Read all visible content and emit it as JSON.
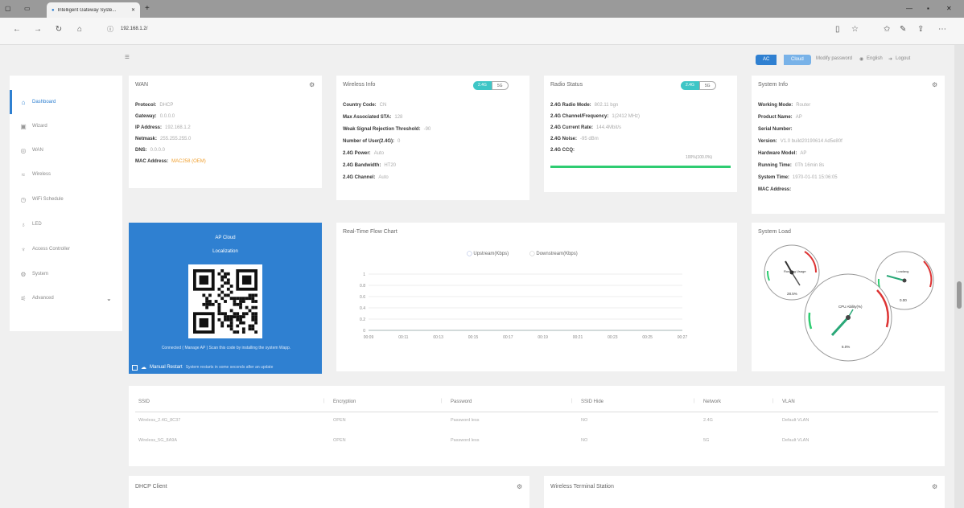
{
  "browser": {
    "tab_title": "Intelligent Gateway Syste...",
    "url": "192.168.1.2/",
    "new_tab": "+"
  },
  "header": {
    "segment": [
      "AC",
      "Cloud"
    ],
    "links": [
      "Modify password",
      "English",
      "Logout"
    ]
  },
  "sidebar": {
    "items": [
      {
        "label": "Dashboard",
        "icon": "home-icon"
      },
      {
        "label": "Wizard",
        "icon": "wizard-icon"
      },
      {
        "label": "WAN",
        "icon": "globe-icon"
      },
      {
        "label": "Wireless",
        "icon": "wifi-icon"
      },
      {
        "label": "WiFi Schedule",
        "icon": "clock-icon"
      },
      {
        "label": "LED",
        "icon": "bulb-icon"
      },
      {
        "label": "Access Controller",
        "icon": "controller-icon"
      },
      {
        "label": "System",
        "icon": "gear-icon"
      },
      {
        "label": "Advanced",
        "icon": "advanced-icon"
      }
    ]
  },
  "wan": {
    "title": "WAN",
    "rows": [
      {
        "k": "Protocol:",
        "v": "DHCP"
      },
      {
        "k": "Gateway:",
        "v": "0.0.0.0"
      },
      {
        "k": "IP Address:",
        "v": "192.168.1.2"
      },
      {
        "k": "Netmask:",
        "v": "255.255.255.0"
      },
      {
        "k": "DNS:",
        "v": "0.0.0.0"
      },
      {
        "k": "MAC Address:",
        "v": "MAC258 (OEM)"
      }
    ]
  },
  "wireless_info": {
    "title": "Wireless Info",
    "toggle": [
      "2.4G",
      "5G"
    ],
    "rows": [
      {
        "k": "Country Code:",
        "v": "CN"
      },
      {
        "k": "Max Associated STA:",
        "v": "128"
      },
      {
        "k": "Weak Signal Rejection Threshold:",
        "v": "-90"
      },
      {
        "k": "Number of User(2.4G):",
        "v": "0"
      },
      {
        "k": "2.4G Power:",
        "v": "Auto"
      },
      {
        "k": "2.4G Bandwidth:",
        "v": "HT20"
      },
      {
        "k": "2.4G Channel:",
        "v": "Auto"
      }
    ]
  },
  "radio_status": {
    "title": "Radio Status",
    "toggle": [
      "2.4G",
      "5G"
    ],
    "rows": [
      {
        "k": "2.4G Radio Mode:",
        "v": "802.11 bgn"
      },
      {
        "k": "2.4G Channel/Frequency:",
        "v": "1(2412 MHz)"
      },
      {
        "k": "2.4G Current Rate:",
        "v": "144.4Mbit/s"
      },
      {
        "k": "2.4G Noise:",
        "v": "-95 dBm"
      },
      {
        "k": "2.4G CCQ:",
        "v": ""
      }
    ],
    "ccq_value": "100%(100.0%)",
    "ccq_fraction": 1.0
  },
  "system_info": {
    "title": "System Info",
    "rows": [
      {
        "k": "Working Mode:",
        "v": "Router"
      },
      {
        "k": "Product Name:",
        "v": "AP"
      },
      {
        "k": "Serial Number:",
        "v": ""
      },
      {
        "k": "Version:",
        "v": "V1.0 build20190614 Ad5e80f"
      },
      {
        "k": "Hardware Model:",
        "v": "AP"
      },
      {
        "k": "Running Time:",
        "v": "0Th 16min 8s"
      },
      {
        "k": "System Time:",
        "v": "1970-01-01 15:06:05"
      },
      {
        "k": "MAC Address:",
        "v": ""
      }
    ]
  },
  "cloud": {
    "title": "AP Cloud",
    "subtitle": "Localization",
    "hint": "Connected ( Manage AP ) Scan this code by installing the system Wapp.",
    "manual": "Manual Restart",
    "manual_note": "System restarts in some seconds after an update"
  },
  "realtime_chart": {
    "title": "Real-Time Flow Chart"
  },
  "chart_data": {
    "type": "line",
    "title": "Real-Time Flow Chart",
    "series": [
      {
        "name": "Upstream(Kbps)",
        "values": [
          0,
          0,
          0,
          0,
          0,
          0,
          0,
          0,
          0,
          0,
          0,
          0,
          0,
          0,
          0,
          0,
          0,
          0,
          0,
          0
        ]
      },
      {
        "name": "Downstream(Kbps)",
        "values": [
          0,
          0,
          0,
          0,
          0,
          0,
          0,
          0,
          0,
          0,
          0,
          0,
          0,
          0,
          0,
          0,
          0,
          0,
          0,
          0
        ]
      }
    ],
    "x_ticks": [
      "00:09",
      "00:11",
      "00:13",
      "00:15",
      "00:17",
      "00:19",
      "00:21",
      "00:23",
      "00:25",
      "00:27"
    ],
    "y_ticks": [
      "0",
      "0.2",
      "0.4",
      "0.6",
      "0.8",
      "1"
    ],
    "ylim": [
      0,
      1
    ],
    "grid": true
  },
  "system_load": {
    "title": "System Load",
    "gauges": [
      {
        "label": "Running Usage",
        "value_text": "28.5%"
      },
      {
        "label": "CPU Ability(%)",
        "value_text": "6.0%"
      },
      {
        "label": "Loadavg",
        "value_text": "0.00"
      }
    ]
  },
  "ssid_table": {
    "headers": [
      "SSID",
      "Encryption",
      "Password",
      "SSID Hide",
      "Network",
      "VLAN"
    ],
    "rows": [
      [
        "Wireless_2.4G_8C37",
        "OPEN",
        "Password less",
        "NO",
        "2.4G",
        "Default VLAN"
      ],
      [
        "Wireless_5G_8A9A",
        "OPEN",
        "Password less",
        "NO",
        "5G",
        "Default VLAN"
      ]
    ]
  },
  "dhcp": {
    "title": "DHCP Client"
  },
  "terminal": {
    "title": "Wireless Terminal Station"
  },
  "colors": {
    "accent": "#2f80d1",
    "teal": "#3ec6c6",
    "green": "#2ecc71",
    "orange": "#f0a030"
  }
}
